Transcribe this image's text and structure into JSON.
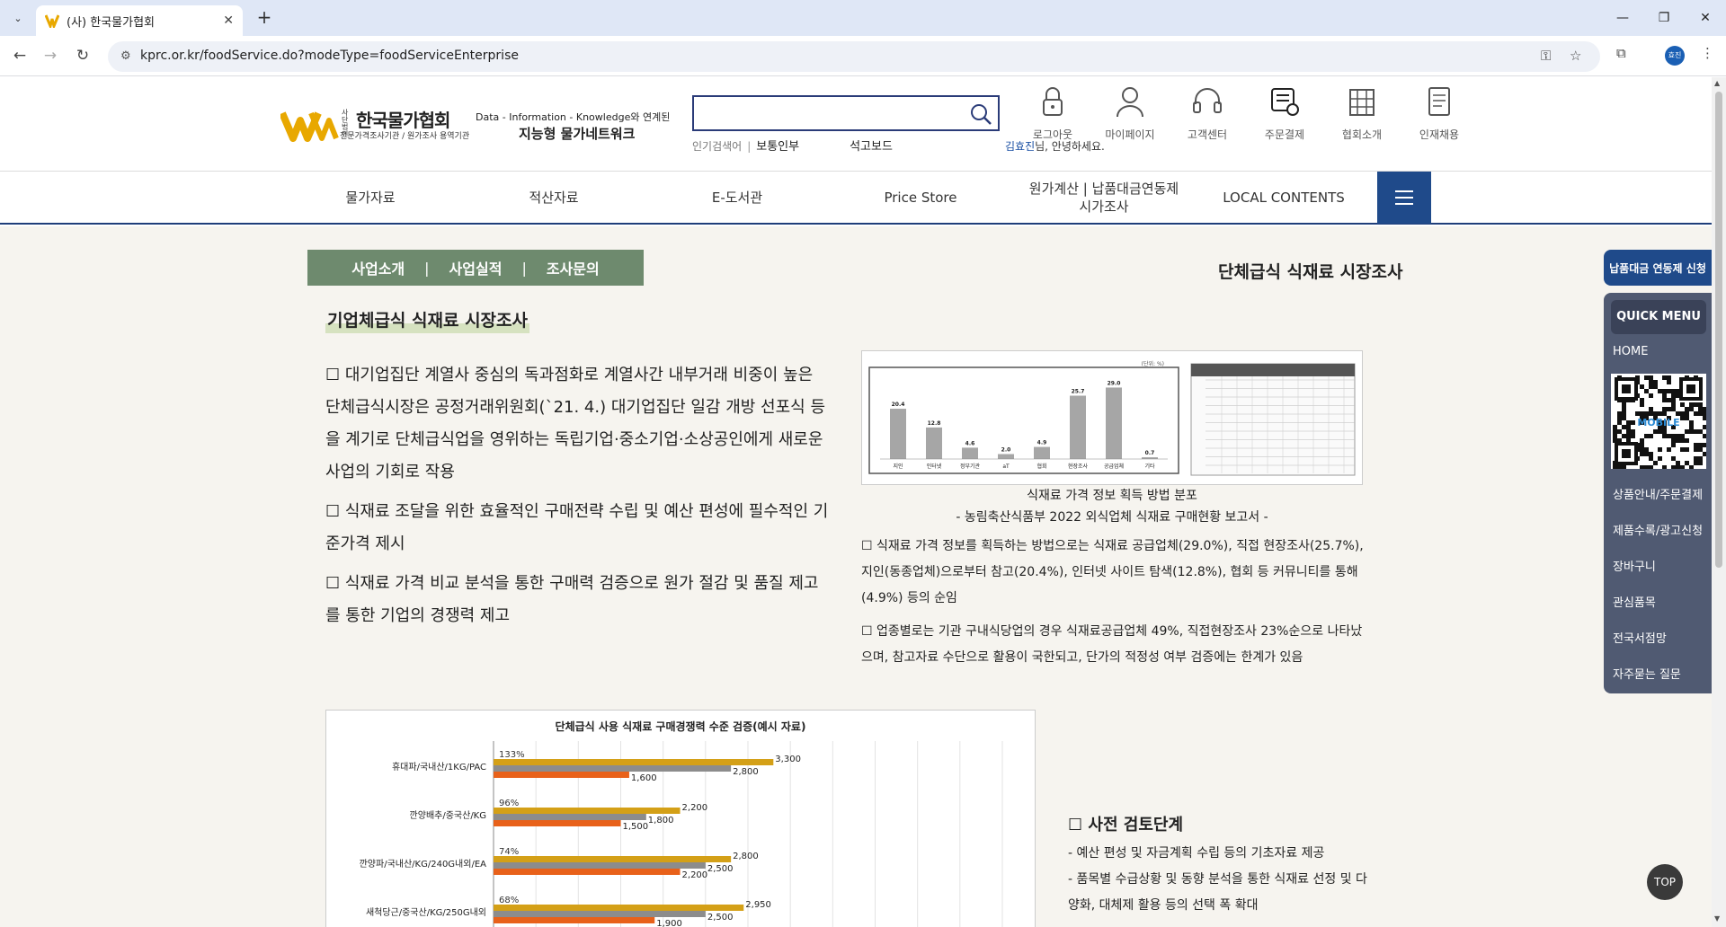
{
  "browser": {
    "tab_title": "(사) 한국물가협회",
    "url": "kprc.or.kr/foodService.do?modeType=foodServiceEnterprise",
    "profile_label": "효진"
  },
  "header": {
    "logo_title": "한국물가협회",
    "logo_prefix": "사단법인",
    "logo_sub": "전문가격조사기관 / 원가조사 용역기관",
    "slogan_line1": "Data - Information - Knowledge와 연계된",
    "slogan_line2": "지능형 물가네트워크",
    "search_value": "",
    "popular_label": "인기검색어",
    "popular_keywords": [
      "보통인부",
      "석고보드"
    ],
    "greeting_user": "김효진",
    "greeting_text": "님, 안녕하세요.",
    "icons": [
      {
        "label": "로그아웃",
        "icon": "lock-icon"
      },
      {
        "label": "마이페이지",
        "icon": "user-icon"
      },
      {
        "label": "고객센터",
        "icon": "headset-icon"
      },
      {
        "label": "주문결제",
        "icon": "cart-icon"
      },
      {
        "label": "협회소개",
        "icon": "building-icon"
      },
      {
        "label": "인재채용",
        "icon": "document-icon"
      }
    ]
  },
  "gnb": {
    "items": [
      "물가자료",
      "적산자료",
      "E-도서관",
      "Price Store",
      "원가계산 | 납품대금연동제\n시가조사",
      "LOCAL CONTENTS"
    ]
  },
  "subnav": {
    "tabs": [
      "사업소개",
      "사업실적",
      "조사문의"
    ]
  },
  "page": {
    "heading": "단체급식 식재료 시장조사",
    "section_title": "기업체급식 식재료 시장조사",
    "bullets_left": [
      "☐ 대기업집단 계열사 중심의 독과점화로 계열사간 내부거래 비중이 높은 단체급식시장은 공정거래위원회(`21. 4.) 대기업집단 일감 개방 선포식 등을 계기로 단체급식업을 영위하는 독립기업·중소기업·소상공인에게 새로운 사업의 기회로 작용",
      "☐ 식재료 조달을 위한 효율적인 구매전략 수립 및 예산 편성에 필수적인 기준가격 제시",
      "☐ 식재료 가격 비교 분석을 통한 구매력 검증으로 원가 절감 및 품질 제고를 통한 기업의 경쟁력 제고"
    ],
    "figure1_caption_line1": "식재료 가격 정보 획득 방법 분포",
    "figure1_caption_line2": "- 농림축산식품부 2022 외식업체 식재료 구매현황 보고서 -",
    "bullets_right": [
      "☐ 식재료 가격 정보를 획득하는 방법으로는 식재료 공급업체(29.0%), 직접 현장조사(25.7%), 지인(동종업체)으로부터 참고(20.4%), 인터넷 사이트 탐색(12.8%), 협회 등 커뮤니티를 통해(4.9%) 등의 순임",
      "☐ 업종별로는 기관 구내식당업의 경우 식재료공급업체 49%, 직접현장조사 23%순으로 나타났으며, 참고자료 수단으로 활용이 국한되고, 단가의 적정성 여부 검증에는 한계가 있음"
    ],
    "step_title": "☐ 사전 검토단계",
    "step_lines": [
      "- 예산 편성 및 자금계획 수립 등의 기초자료 제공",
      "- 품목별 수급상황 및 동향 분석을 통한 식재료 선정 및 다양화, 대체제 활용 등의 선택 폭 확대"
    ]
  },
  "chart_data": [
    {
      "type": "bar",
      "title": "",
      "unit_label": "(단위: %)",
      "categories": [
        "지인",
        "인터넷",
        "정부기관",
        "aT",
        "협회",
        "현장조사",
        "공급업체",
        "기타"
      ],
      "values": [
        20.4,
        12.8,
        4.6,
        2.0,
        4.9,
        25.7,
        29.0,
        0.7
      ],
      "ylim": [
        0,
        35
      ],
      "color": "#a6a6a6"
    },
    {
      "type": "bar",
      "orientation": "horizontal",
      "title": "단체급식 사용 식재료 구매경쟁력 수준 검증(예시 자료)",
      "categories": [
        "휴대파/국내산/1KG/PAC",
        "깐양배추/중국산/KG",
        "깐양파/국내산/KG/240G내외/EA",
        "새척당근/중국산/KG/250G내외"
      ],
      "percent_labels": [
        "133%",
        "96%",
        "74%",
        "68%"
      ],
      "series": [
        {
          "values": [
            3300,
            2200,
            2800,
            2950
          ],
          "color": "#d4a017"
        },
        {
          "values": [
            2800,
            1800,
            2500,
            2500
          ],
          "color": "#8c8c8c"
        },
        {
          "values": [
            1600,
            1500,
            2200,
            1900
          ],
          "color": "#e8611a"
        }
      ],
      "xlim": [
        0,
        6000
      ]
    }
  ],
  "quick_menu": {
    "banner": "납품대금 연동제 신청",
    "head": "QUICK MENU",
    "items_top": [
      "HOME"
    ],
    "qr_label": "MOBILE",
    "items": [
      "상품안내/주문결제",
      "제품수록/광고신청",
      "장바구니",
      "관심품목",
      "전국서점망",
      "자주묻는 질문"
    ],
    "top_button": "TOP"
  }
}
